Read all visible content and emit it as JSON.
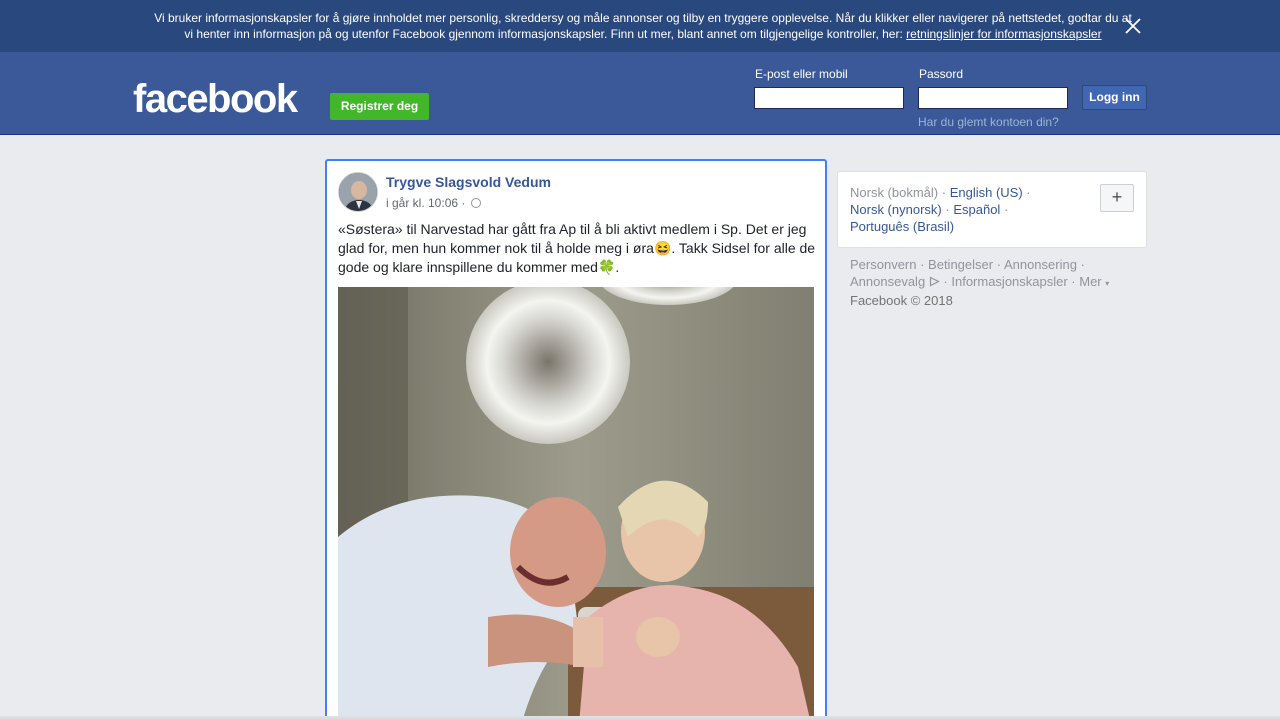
{
  "cookie_banner": {
    "text": "Vi bruker informasjonskapsler for å gjøre innholdet mer personlig, skreddersy og måle annonser og tilby en tryggere opplevelse. Når du klikker eller navigerer på nettstedet, godtar du at vi henter inn informasjon på og utenfor Facebook gjennom informasjonskapsler. Finn ut mer, blant annet om tilgjengelige kontroller, her:",
    "link_text": "retningslinjer for informasjonskapsler",
    "close_icon": "close-icon"
  },
  "header": {
    "logo": "facebook",
    "register_label": "Registrer deg",
    "email_label": "E-post eller mobil",
    "password_label": "Passord",
    "email_value": "",
    "password_value": "",
    "login_label": "Logg inn",
    "forgot_label": "Har du glemt kontoen din?"
  },
  "post": {
    "author": "Trygve Slagsvold Vedum",
    "time": "i går kl. 10:06 ·",
    "privacy_icon": "globe-icon",
    "text_part1": "«Søstera» til Narvestad har gått fra Ap til å bli aktivt medlem i Sp. Det er jeg glad for, men hun kommer nok til å holde meg i øra",
    "emoji1": "😆",
    "text_part2": ". Takk Sidsel for alle de gode og klare innspillene du kommer med",
    "emoji2": "🍀",
    "text_part3": "."
  },
  "languages": {
    "current": "Norsk (bokmål)",
    "links": [
      "English (US)",
      "Norsk (nynorsk)",
      "Español",
      "Português (Brasil)"
    ],
    "add_label": "+"
  },
  "footer": {
    "links": [
      "Personvern",
      "Betingelser",
      "Annonsering",
      "Annonsevalg",
      "Informasjonskapsler",
      "Mer"
    ],
    "copyright": "Facebook © 2018"
  },
  "colors": {
    "brand_blue": "#3b5998",
    "banner_blue": "#29487d",
    "register_green": "#42b72a",
    "link_blue": "#365899",
    "background": "#e9ebee"
  }
}
